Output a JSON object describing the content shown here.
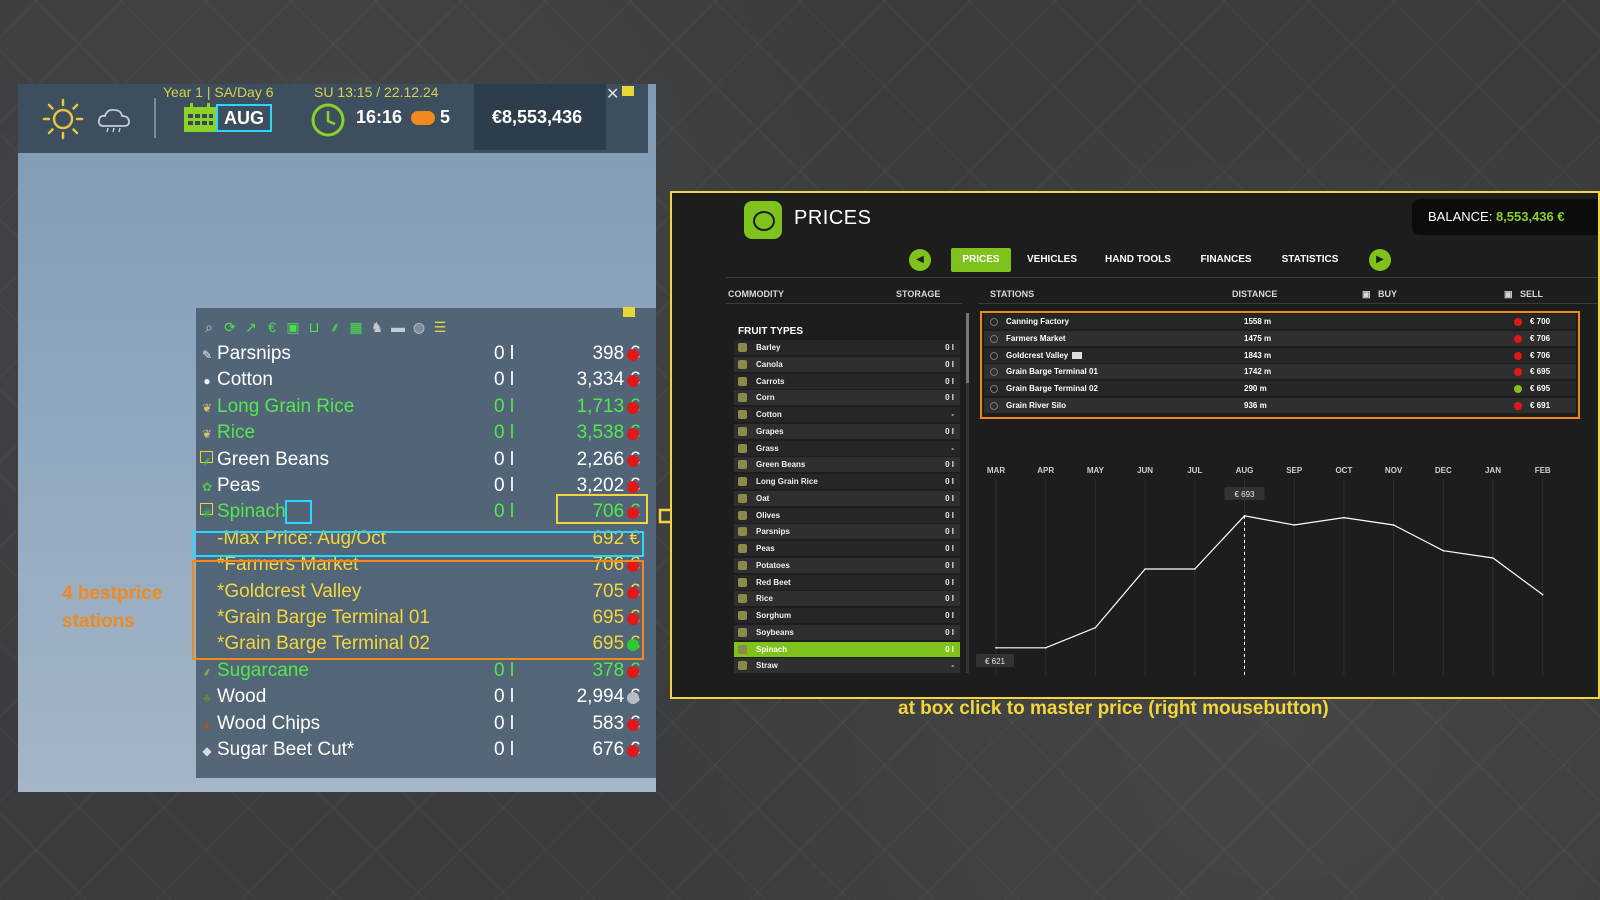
{
  "hud": {
    "date_line": "Year 1 | SA/Day 6",
    "month": "AUG",
    "datetime_line": "SU 13:15 / 22.12.24",
    "time": "16:16",
    "speed": "5",
    "money": "€8,553,436",
    "close_glyph": "✕",
    "icons": [
      "sun-icon",
      "cloud-icon",
      "calendar-icon",
      "clock-icon",
      "fast-forward-icon",
      "close-icon",
      "pin-icon"
    ]
  },
  "toolbar_icons": [
    "search-icon",
    "refresh-icon",
    "trend-icon",
    "euro-icon",
    "box-icon",
    "bracket-icon",
    "grain-icon",
    "calendar-grid-icon",
    "cow-icon",
    "bale-icon",
    "wool-icon",
    "clear-filter-icon"
  ],
  "price_rows": [
    {
      "name": "Parsnips",
      "qty": "0 l",
      "price": "398 €",
      "style": "white",
      "dot": "red",
      "icon": "parsnip-icon"
    },
    {
      "name": "Cotton",
      "qty": "0 l",
      "price": "3,334 €",
      "style": "white",
      "dot": "red",
      "icon": "cotton-icon"
    },
    {
      "name": "Long Grain Rice",
      "qty": "0 l",
      "price": "1,713 €",
      "style": "green",
      "dot": "red",
      "icon": "rice-icon"
    },
    {
      "name": "Rice",
      "qty": "0 l",
      "price": "3,538 €",
      "style": "green",
      "dot": "red",
      "icon": "rice-icon"
    },
    {
      "name": "Green Beans",
      "qty": "0 l",
      "price": "2,266 €",
      "style": "white",
      "dot": "red",
      "icon": "beans-icon",
      "cal": true
    },
    {
      "name": "Peas",
      "qty": "0 l",
      "price": "3,202 €",
      "style": "white",
      "dot": "red",
      "icon": "peas-icon"
    },
    {
      "name": "Spinach",
      "qty": "0 l",
      "price": "706 €",
      "style": "green",
      "dot": "red",
      "icon": "spinach-icon",
      "cal": true
    },
    {
      "name": "-Max Price: Aug/Oct",
      "qty": "",
      "price": "692 €",
      "style": "yellow",
      "dot": "none"
    },
    {
      "name": "*Farmers Market",
      "qty": "",
      "price": "706 €",
      "style": "yellow",
      "dot": "red"
    },
    {
      "name": "*Goldcrest Valley",
      "qty": "",
      "price": "705 €",
      "style": "yellow",
      "dot": "red"
    },
    {
      "name": "*Grain Barge Terminal 01",
      "qty": "",
      "price": "695 €",
      "style": "yellow",
      "dot": "red"
    },
    {
      "name": "*Grain Barge Terminal 02",
      "qty": "",
      "price": "695 €",
      "style": "yellow",
      "dot": "green"
    },
    {
      "name": "Sugarcane",
      "qty": "0 l",
      "price": "378 €",
      "style": "green",
      "dot": "red",
      "icon": "sugarcane-icon"
    },
    {
      "name": "Wood",
      "qty": "0 l",
      "price": "2,994 €",
      "style": "white",
      "dot": "grey",
      "icon": "tree-icon"
    },
    {
      "name": "Wood Chips",
      "qty": "0 l",
      "price": "583 €",
      "style": "white",
      "dot": "red",
      "icon": "woodchips-icon"
    },
    {
      "name": "Sugar Beet Cut*",
      "qty": "0 l",
      "price": "676 €",
      "style": "white",
      "dot": "red",
      "icon": "sugarbeet-icon"
    }
  ],
  "annotation_best": "4 bestprice stations",
  "caption": "at box click to master price (right mousebutton)",
  "prices_screen": {
    "title": "PRICES",
    "balance_label": "BALANCE:",
    "balance_value": "8,553,436 €",
    "tabs": [
      "PRICES",
      "VEHICLES",
      "HAND TOOLS",
      "FINANCES",
      "STATISTICS"
    ],
    "active_tab": "PRICES",
    "columns": {
      "commodity": "COMMODITY",
      "storage": "STORAGE",
      "stations": "STATIONS",
      "distance": "DISTANCE",
      "buy": "BUY",
      "sell": "SELL"
    },
    "fruit_types_title": "FRUIT TYPES",
    "fruits": [
      {
        "name": "Barley",
        "qty": "0 l"
      },
      {
        "name": "Canola",
        "qty": "0 l"
      },
      {
        "name": "Carrots",
        "qty": "0 l"
      },
      {
        "name": "Corn",
        "qty": "0 l"
      },
      {
        "name": "Cotton",
        "qty": "-"
      },
      {
        "name": "Grapes",
        "qty": "0 l"
      },
      {
        "name": "Grass",
        "qty": "-"
      },
      {
        "name": "Green Beans",
        "qty": "0 l"
      },
      {
        "name": "Long Grain Rice",
        "qty": "0 l"
      },
      {
        "name": "Oat",
        "qty": "0 l"
      },
      {
        "name": "Olives",
        "qty": "0 l"
      },
      {
        "name": "Parsnips",
        "qty": "0 l"
      },
      {
        "name": "Peas",
        "qty": "0 l"
      },
      {
        "name": "Potatoes",
        "qty": "0 l"
      },
      {
        "name": "Red Beet",
        "qty": "0 l"
      },
      {
        "name": "Rice",
        "qty": "0 l"
      },
      {
        "name": "Sorghum",
        "qty": "0 l"
      },
      {
        "name": "Soybeans",
        "qty": "0 l"
      },
      {
        "name": "Spinach",
        "qty": "0 l",
        "selected": true
      },
      {
        "name": "Straw",
        "qty": "-"
      }
    ],
    "stations": [
      {
        "name": "Canning Factory",
        "distance": "1558 m",
        "price": "€ 700",
        "dot": "red"
      },
      {
        "name": "Farmers Market",
        "distance": "1475 m",
        "price": "€ 706",
        "dot": "red"
      },
      {
        "name": "Goldcrest Valley",
        "distance": "1843 m",
        "price": "€ 706",
        "dot": "red",
        "truck": true
      },
      {
        "name": "Grain Barge Terminal 01",
        "distance": "1742 m",
        "price": "€ 695",
        "dot": "red"
      },
      {
        "name": "Grain Barge Terminal 02",
        "distance": "290 m",
        "price": "€ 695",
        "dot": "green"
      },
      {
        "name": "Grain River Silo",
        "distance": "936 m",
        "price": "€ 691",
        "dot": "red"
      }
    ]
  },
  "chart_data": {
    "type": "line",
    "categories": [
      "MAR",
      "APR",
      "MAY",
      "JUN",
      "JUL",
      "AUG",
      "SEP",
      "OCT",
      "NOV",
      "DEC",
      "JAN",
      "FEB"
    ],
    "values": [
      621,
      621,
      632,
      664,
      664,
      693,
      688,
      692,
      688,
      674,
      670,
      650
    ],
    "ylim": [
      610,
      700
    ],
    "current_index": 5,
    "labels": {
      "current": "€ 693",
      "min": "€ 621"
    },
    "grid": true,
    "line_color": "#ffffff"
  }
}
